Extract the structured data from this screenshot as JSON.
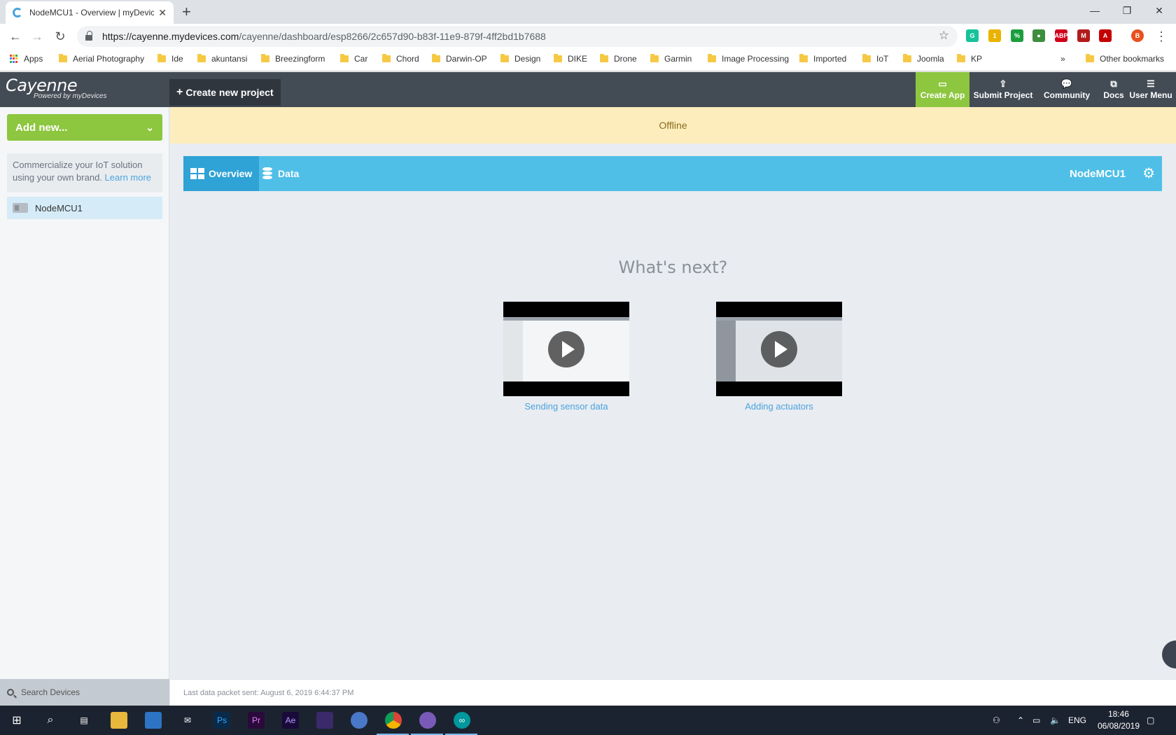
{
  "browser": {
    "tab_title": "NodeMCU1 - Overview | myDevic",
    "url_host": "https://cayenne.mydevices.com",
    "url_path": "/cayenne/dashboard/esp8266/2c657d90-b83f-11e9-879f-4ff2bd1b7688",
    "bookmarks": [
      "Apps",
      "Aerial Photography",
      "Ide",
      "akuntansi",
      "Breezingform",
      "Car",
      "Chord",
      "Darwin-OP",
      "Design",
      "DIKE",
      "Drone",
      "Garmin",
      "Image Processing",
      "Imported",
      "IoT",
      "Joomla",
      "KP"
    ],
    "other_bookmarks": "Other bookmarks",
    "overflow": "»",
    "extensions": [
      {
        "label": "G",
        "color": "#15c39a",
        "icon": "grammarly-icon"
      },
      {
        "label": "1",
        "color": "#e8b400",
        "icon": "note-extension-icon"
      },
      {
        "label": "%",
        "color": "#1b9e3e",
        "icon": "percent-extension-icon"
      },
      {
        "label": "●",
        "color": "#3e8e3e",
        "icon": "globe-extension-icon"
      },
      {
        "label": "ABP",
        "color": "#d0021b",
        "icon": "adblock-icon"
      },
      {
        "label": "M",
        "color": "#b31b1b",
        "icon": "mendeley-icon"
      },
      {
        "label": "A",
        "color": "#c40000",
        "icon": "acrobat-icon"
      },
      {
        "label": "B",
        "color": "#e8501e",
        "icon": "profile-avatar-icon"
      }
    ]
  },
  "header": {
    "brand_name": "Cayenne",
    "brand_sub": "Powered by myDevices",
    "create_project": "Create new project",
    "menu": [
      {
        "label": "Create App",
        "icon": "▭"
      },
      {
        "label": "Submit Project",
        "icon": "⇪"
      },
      {
        "label": "Community",
        "icon": "💬"
      },
      {
        "label": "Docs",
        "icon": "⧉"
      },
      {
        "label": "User Menu",
        "icon": "☰"
      }
    ]
  },
  "sidebar": {
    "add_new": "Add new...",
    "promo_text": "Commercialize your IoT solution using your own brand.",
    "promo_link": "Learn more",
    "device": "NodeMCU1",
    "search_placeholder": "Search Devices"
  },
  "main": {
    "status_banner": "Offline",
    "tabs": [
      "Overview",
      "Data"
    ],
    "device_name": "NodeMCU1",
    "whats_next": "What's next?",
    "videos": [
      "Sending sensor data",
      "Adding actuators"
    ],
    "footer": "Last data packet sent: August 6, 2019 6:44:37 PM"
  },
  "taskbar": {
    "language": "ENG",
    "time": "18:46",
    "date": "06/08/2019"
  }
}
